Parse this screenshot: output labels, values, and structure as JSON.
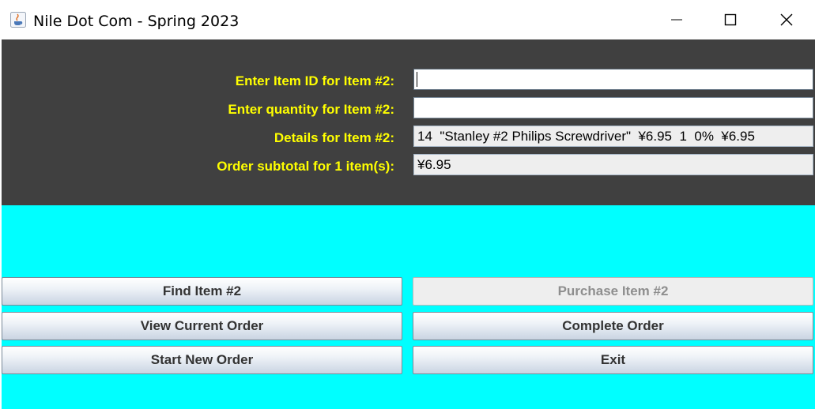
{
  "window": {
    "title": "Nile Dot Com - Spring 2023"
  },
  "form": {
    "item_id_label": "Enter Item ID for Item #2:",
    "item_id_value": "",
    "quantity_label": "Enter quantity for Item #2:",
    "quantity_value": "",
    "details_label": "Details for Item #2:",
    "details_value": "14  \"Stanley #2 Philips Screwdriver\"  ¥6.95  1  0%  ¥6.95",
    "subtotal_label": "Order subtotal for 1 item(s):",
    "subtotal_value": "¥6.95"
  },
  "buttons": {
    "find": "Find Item #2",
    "purchase": "Purchase Item #2",
    "view": "View Current Order",
    "complete": "Complete Order",
    "start_new": "Start New Order",
    "exit": "Exit"
  },
  "colors": {
    "panel": "#404040",
    "label": "#ffff00",
    "background": "#00ffff"
  }
}
